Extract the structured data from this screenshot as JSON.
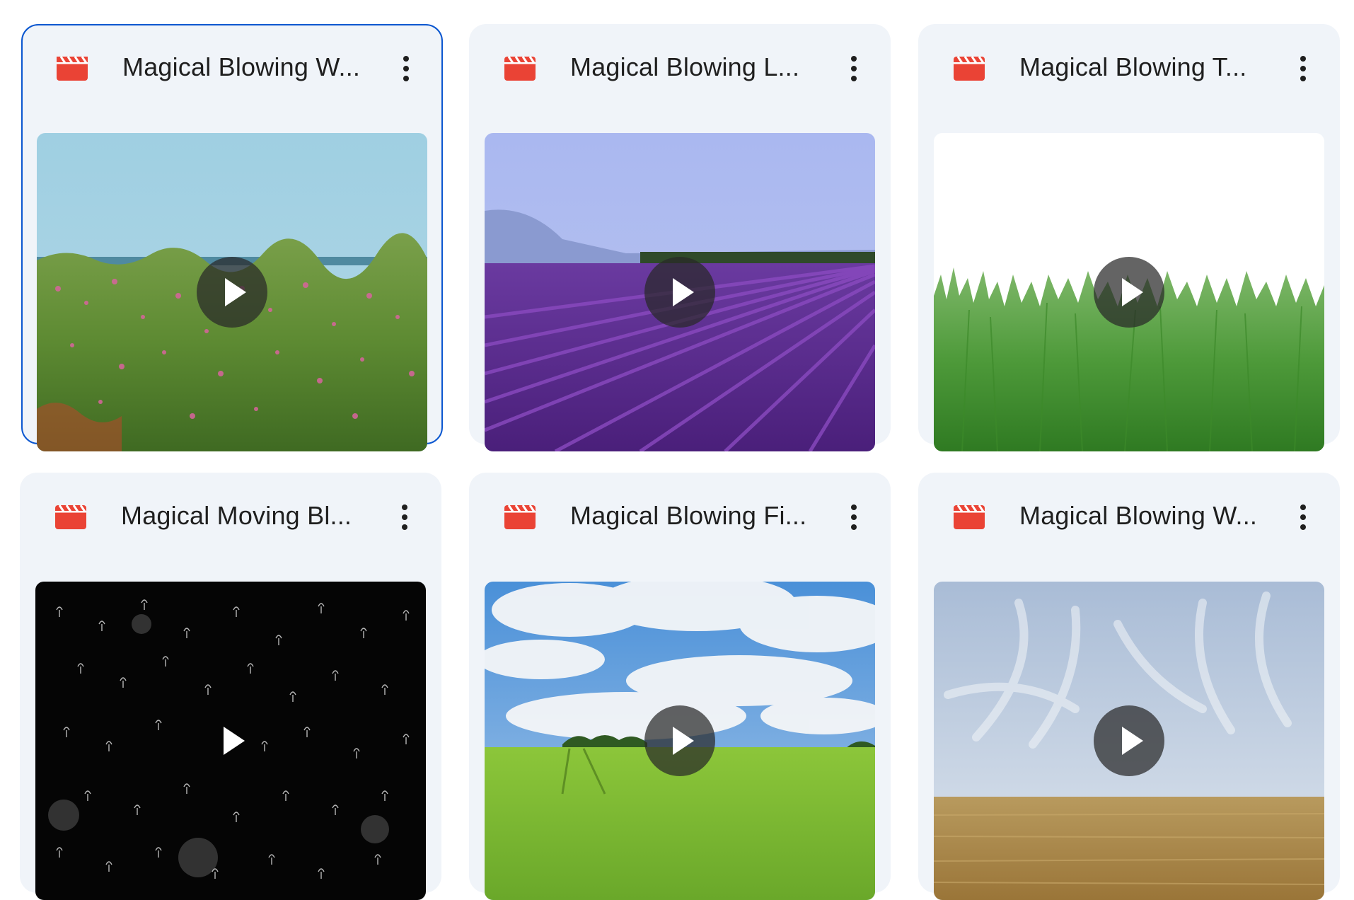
{
  "files": [
    {
      "title": "Magical Blowing W...",
      "file_icon": "video-file-icon",
      "selected": true
    },
    {
      "title": "Magical Blowing L...",
      "file_icon": "video-file-icon",
      "selected": false
    },
    {
      "title": "Magical Blowing T...",
      "file_icon": "video-file-icon",
      "selected": false
    },
    {
      "title": "Magical Moving Bl...",
      "file_icon": "video-file-icon",
      "selected": false
    },
    {
      "title": "Magical Blowing Fi...",
      "file_icon": "video-file-icon",
      "selected": false
    },
    {
      "title": "Magical Blowing W...",
      "file_icon": "video-file-icon",
      "selected": false
    }
  ],
  "colors": {
    "card_background": "#f0f4f9",
    "selected_border": "#0b57d0",
    "video_icon": "#ea4335",
    "play_button": "#282828"
  },
  "icons": {
    "more": "more-vert-icon",
    "play": "play-icon"
  }
}
